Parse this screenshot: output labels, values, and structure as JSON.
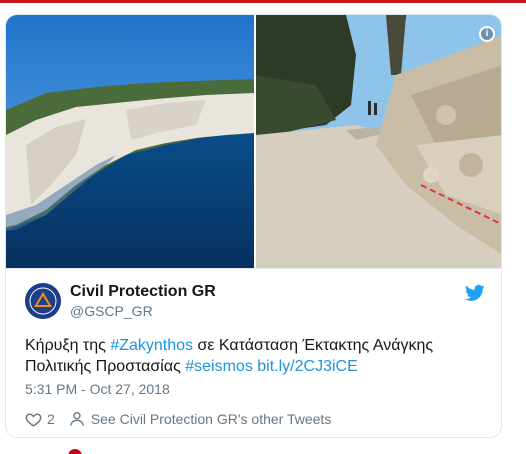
{
  "tweet": {
    "author_name": "Civil Protection GR",
    "author_handle": "@GSCP_GR",
    "text_prefix": "Κήρυξη της ",
    "hashtag1": "#Zakynthos",
    "text_mid1": " σε Κατάσταση Έκτακτης Ανάγκης",
    "text_line2": "Πολιτικής Προστασίας ",
    "hashtag2": "#seismos",
    "link": "bit.ly/2CJ3iCE",
    "timestamp": "5:31 PM - Oct 27, 2018",
    "like_count": "2",
    "other_tweets_label": "See Civil Protection GR's other Tweets"
  },
  "icons": {
    "info": "info-icon",
    "platform": "twitter-bird-icon",
    "like": "heart-icon",
    "profile": "person-icon"
  },
  "colors": {
    "link": "#1b95e0",
    "secondary_text": "#657786",
    "border": "#e1e8ed",
    "top_accent": "#c8161d"
  }
}
